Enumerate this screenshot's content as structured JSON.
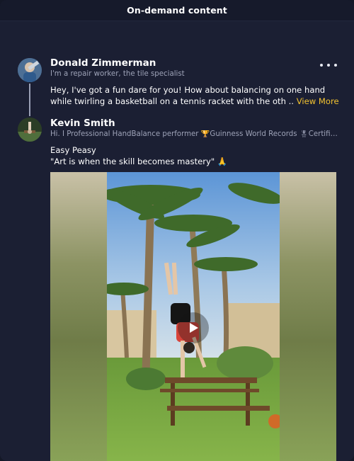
{
  "header": {
    "title": "On-demand content"
  },
  "post": {
    "author": {
      "name": "Donald Zimmerman",
      "bio": "I'm a repair worker, the tile specialist",
      "avatar_icon": "user-photo-icon"
    },
    "text": "Hey, I've got a fun dare for you! How about balancing on one hand while twirling a basketball on a tennis racket with the oth ..",
    "view_more_label": "View More",
    "more_icon": "more-options-icon"
  },
  "reply": {
    "author": {
      "name": "Kevin Smith",
      "bio": "Hi. I Professional HandBalance performer 🏆Guinness World Records 🎖Certifice ...",
      "avatar_icon": "user-photo-icon"
    },
    "line1": "Easy Peasy",
    "line2": "\"Art is when the skill becomes mastery\" 🙏",
    "media": {
      "type": "video",
      "play_icon": "play-icon"
    }
  },
  "colors": {
    "background": "#1b1f33",
    "header": "#161a2b",
    "accent_link": "#f2c230",
    "muted_text": "#9ea3b8"
  }
}
